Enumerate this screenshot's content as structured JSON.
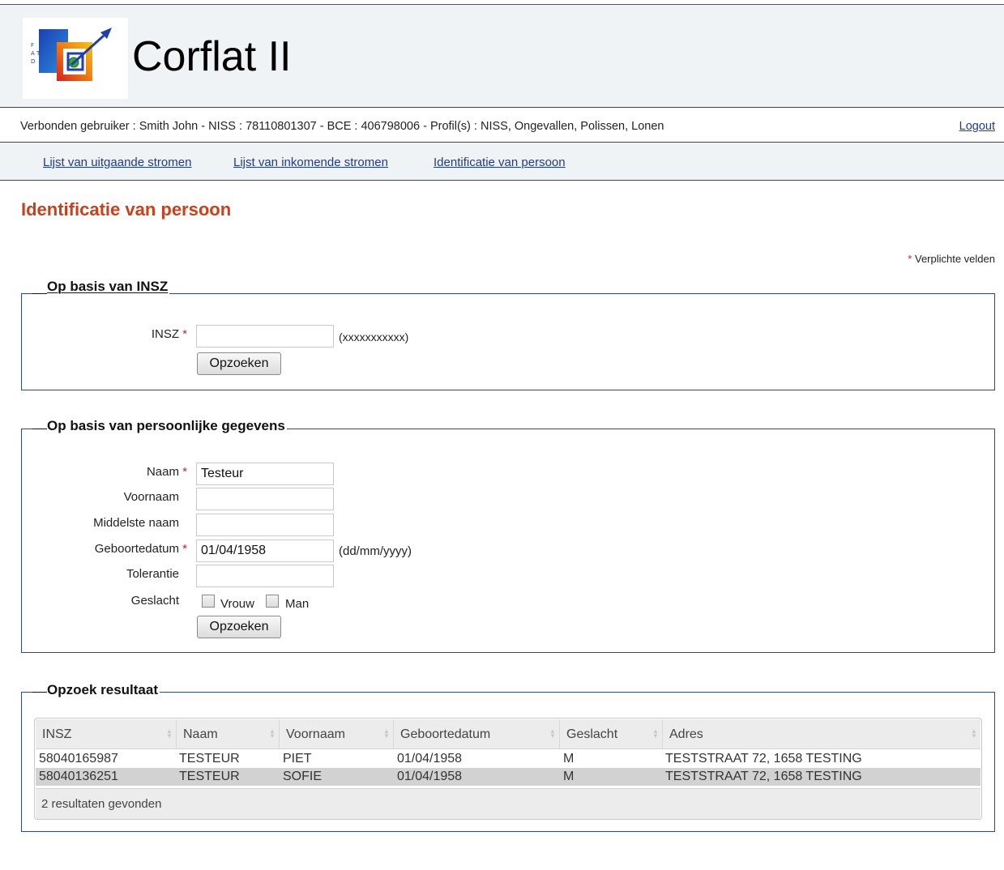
{
  "app": {
    "title": "Corflat II",
    "logo_text": "F A T D",
    "colors": {
      "title_red": "#c9401b",
      "link_blue": "#1f3c8a",
      "header_bg": "#f0f3f6",
      "box_border": "#2e4a7a"
    }
  },
  "userbar": {
    "info": "Verbonden gebruiker : Smith John - NISS : 78110801307 - BCE : 406798006 - Profil(s) : NISS, Ongevallen, Polissen, Lonen",
    "logout": "Logout"
  },
  "nav": {
    "items": [
      {
        "label": "Lijst van uitgaande stromen"
      },
      {
        "label": "Lijst van inkomende stromen"
      },
      {
        "label": "Identificatie van persoon"
      }
    ]
  },
  "page": {
    "title": "Identificatie van persoon",
    "required_star": "*",
    "required_note": "Verplichte velden"
  },
  "insz_section": {
    "legend": "Op basis van INSZ",
    "insz_label": "INSZ",
    "insz_value": "",
    "insz_hint": "(xxxxxxxxxxx)",
    "search_button": "Opzoeken"
  },
  "personal_section": {
    "legend": "Op basis van persoonlijke gegevens",
    "name_label": "Naam",
    "name_value": "Testeur",
    "firstname_label": "Voornaam",
    "firstname_value": "",
    "middlename_label": "Middelste naam",
    "middlename_value": "",
    "birthdate_label": "Geboortedatum",
    "birthdate_value": "01/04/1958",
    "birthdate_hint": "(dd/mm/yyyy)",
    "tolerance_label": "Tolerantie",
    "tolerance_value": "",
    "gender_label": "Geslacht",
    "gender_female": "Vrouw",
    "gender_male": "Man",
    "gender_female_checked": false,
    "gender_male_checked": false,
    "search_button": "Opzoeken"
  },
  "results_section": {
    "legend": "Opzoek resultaat",
    "columns": [
      "INSZ",
      "Naam",
      "Voornaam",
      "Geboortedatum",
      "Geslacht",
      "Adres"
    ],
    "rows": [
      [
        "58040165987",
        "TESTEUR",
        "PIET",
        "01/04/1958",
        "M",
        "TESTSTRAAT 72, 1658 TESTING"
      ],
      [
        "58040136251",
        "TESTEUR",
        "SOFIE",
        "01/04/1958",
        "M",
        "TESTSTRAAT 72, 1658 TESTING"
      ]
    ],
    "footer": "2 resultaten gevonden"
  }
}
